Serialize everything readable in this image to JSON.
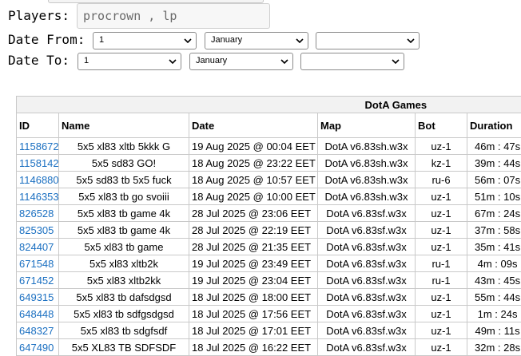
{
  "filters": {
    "players_label": "Players:",
    "players_value": "procrown , lp",
    "date_from_label": "Date From:",
    "date_to_label": "Date To:",
    "from_day": "1",
    "from_month": "January",
    "from_year": "",
    "to_day": "1",
    "to_month": "January",
    "to_year": ""
  },
  "table": {
    "caption": "DotA Games",
    "columns": [
      "ID",
      "Name",
      "Date",
      "Map",
      "Bot",
      "Duration"
    ],
    "rows": [
      {
        "id": "1158672",
        "name": "5x5 xl83 xltb 5kkk G",
        "date": "19 Aug 2025 @ 00:04 EET",
        "map": "DotA v6.83sh.w3x",
        "bot": "uz-1",
        "duration": "46m : 47s"
      },
      {
        "id": "1158142",
        "name": "5x5 sd83 GO!",
        "date": "18 Aug 2025 @ 23:22 EET",
        "map": "DotA v6.83sh.w3x",
        "bot": "kz-1",
        "duration": "39m : 44s"
      },
      {
        "id": "1146880",
        "name": "5x5 sd83 tb 5x5 fuck",
        "date": "18 Aug 2025 @ 10:57 EET",
        "map": "DotA v6.83sh.w3x",
        "bot": "ru-6",
        "duration": "56m : 07s"
      },
      {
        "id": "1146353",
        "name": "5x5 xl83 tb go svoiii",
        "date": "18 Aug 2025 @ 10:00 EET",
        "map": "DotA v6.83sh.w3x",
        "bot": "uz-1",
        "duration": "51m : 10s"
      },
      {
        "id": "826528",
        "name": "5x5 xl83 tb game 4k",
        "date": "28 Jul 2025 @ 23:06 EET",
        "map": "DotA v6.83sf.w3x",
        "bot": "uz-1",
        "duration": "67m : 24s"
      },
      {
        "id": "825305",
        "name": "5x5 xl83 tb game 4k",
        "date": "28 Jul 2025 @ 22:19 EET",
        "map": "DotA v6.83sf.w3x",
        "bot": "uz-1",
        "duration": "37m : 58s"
      },
      {
        "id": "824407",
        "name": "5x5 xl83 tb game",
        "date": "28 Jul 2025 @ 21:35 EET",
        "map": "DotA v6.83sf.w3x",
        "bot": "uz-1",
        "duration": "35m : 41s"
      },
      {
        "id": "671548",
        "name": "5x5 xl83 xltb2k",
        "date": "19 Jul 2025 @ 23:49 EET",
        "map": "DotA v6.83sf.w3x",
        "bot": "ru-1",
        "duration": "4m : 09s"
      },
      {
        "id": "671452",
        "name": "5x5 xl83 xltb2kk",
        "date": "19 Jul 2025 @ 23:04 EET",
        "map": "DotA v6.83sf.w3x",
        "bot": "ru-1",
        "duration": "43m : 45s"
      },
      {
        "id": "649315",
        "name": "5x5 xl83 tb dafsdgsd",
        "date": "18 Jul 2025 @ 18:00 EET",
        "map": "DotA v6.83sf.w3x",
        "bot": "uz-1",
        "duration": "55m : 44s"
      },
      {
        "id": "648448",
        "name": "5x5 xl83 tb sdfgsdgsd",
        "date": "18 Jul 2025 @ 17:56 EET",
        "map": "DotA v6.83sf.w3x",
        "bot": "uz-1",
        "duration": "1m : 24s"
      },
      {
        "id": "648327",
        "name": "5x5 xl83 tb sdgfsdf",
        "date": "18 Jul 2025 @ 17:01 EET",
        "map": "DotA v6.83sf.w3x",
        "bot": "uz-1",
        "duration": "49m : 11s"
      },
      {
        "id": "647490",
        "name": "5x5 XL83 TB SDFSDF",
        "date": "18 Jul 2025 @ 16:22 EET",
        "map": "DotA v6.83sf.w3x",
        "bot": "uz-1",
        "duration": "32m : 28s"
      }
    ]
  },
  "colors": {
    "link": "#1a6fc1",
    "caption_bg": "#f2f2f2",
    "border": "#c9c9c9"
  }
}
